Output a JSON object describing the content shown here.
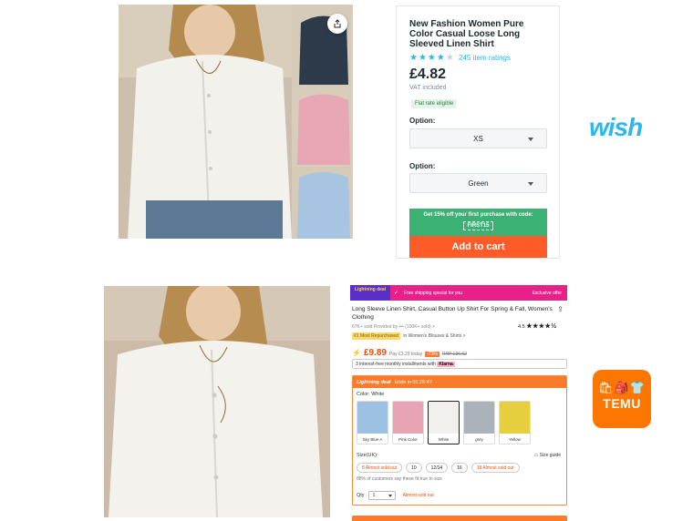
{
  "wish": {
    "title": "New Fashion Women Pure Color Casual Loose Long Sleeved Linen Shirt",
    "rating_stars": "★★★★",
    "rating_stars_off": "★",
    "rating_count": "245 item ratings",
    "price": "£4.82",
    "vat": "VAT included",
    "badge": "Flat rate eligible",
    "option1_label": "Option:",
    "option1_value": "XS",
    "option2_label": "Option:",
    "option2_value": "Green",
    "promo_text": "Get 15% off your first purchase with code:",
    "promo_code": "FIRST15",
    "add_to_cart": "Add to cart",
    "logo_text": "wish",
    "accent_color": "#2fb7ec",
    "cta_color": "#fd5c29"
  },
  "temu": {
    "banner_tag": "Lightning deal",
    "banner_shipping": "Free shipping special for you",
    "banner_exclusive": "Exclusive offer",
    "title": "Long Sleeve Linen Shirt, Casual Button Up Shirt For Spring & Fall, Women's Clothing",
    "sold": "67K+ sold  Provided by ••• (100K+ sold) >",
    "rating": "4.5",
    "rating_stars": "★★★★½",
    "bestseller_tag": "#1 Most Repurchased",
    "bestseller_cat": "in Women's Blouses & Shirts >",
    "price": "£9.89",
    "pay_text": "Pay £3.29 today",
    "discount": "-73%",
    "rrp": "RRP £36.62",
    "installments": "3 interest-free monthly installments with",
    "klarna": "Klarna",
    "deal_title": "Lightning deal",
    "deal_timer": "Ends in 01:25:47",
    "color_label": "Color: White",
    "colors": [
      {
        "name": "Sky Blue A",
        "hex": "#9cc1e2"
      },
      {
        "name": "Pink Color",
        "hex": "#e7a2b4"
      },
      {
        "name": "White",
        "hex": "#f2f0ec"
      },
      {
        "name": "grey",
        "hex": "#aab3ba"
      },
      {
        "name": "Yellow",
        "hex": "#e6cf3f"
      }
    ],
    "size_label": "Size(UK):",
    "size_guide": "Size guide",
    "sizes": [
      "8 Almost sold out",
      "10",
      "12/14",
      "16",
      "18 Almost sold out"
    ],
    "fit_note": "88% of customers say these fit true to size",
    "qty_label": "Qty",
    "qty_value": "1",
    "qty_warning": "Almost sold out",
    "logo_glyphs": "🛍🎒👕",
    "logo_text": "TEMU",
    "brand_color": "#fb7701"
  }
}
